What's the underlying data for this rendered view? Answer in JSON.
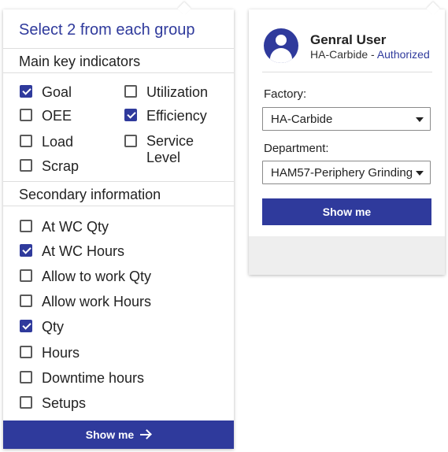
{
  "left_panel": {
    "title": "Select 2 from each group",
    "main_section": {
      "heading": "Main key indicators",
      "options": [
        {
          "label": "Goal",
          "checked": true
        },
        {
          "label": "Utilization",
          "checked": false
        },
        {
          "label": "OEE",
          "checked": false
        },
        {
          "label": "Efficiency",
          "checked": true
        },
        {
          "label": "Load",
          "checked": false
        },
        {
          "label": "Service Level",
          "checked": false
        },
        {
          "label": "Scrap",
          "checked": false
        }
      ]
    },
    "secondary_section": {
      "heading": "Secondary information",
      "options": [
        {
          "label": "At WC Qty",
          "checked": false
        },
        {
          "label": "At WC Hours",
          "checked": true
        },
        {
          "label": "Allow to work Qty",
          "checked": false
        },
        {
          "label": "Allow work Hours",
          "checked": false
        },
        {
          "label": "Qty",
          "checked": true
        },
        {
          "label": "Hours",
          "checked": false
        },
        {
          "label": "Downtime hours",
          "checked": false
        },
        {
          "label": "Setups",
          "checked": false
        }
      ]
    },
    "show_me_label": "Show me",
    "show_me_icon": "arrow-right-icon"
  },
  "right_panel": {
    "user_name": "Genral User",
    "user_org": "HA-Carbide",
    "separator": " - ",
    "user_status": "Authorized",
    "factory_label": "Factory:",
    "factory_value": "HA-Carbide",
    "department_label": "Department:",
    "department_value": "HAM57-Periphery Grinding",
    "show_me_label": "Show me"
  },
  "colors": {
    "accent": "#2f3a9c",
    "footer_bg": "#eeeeee"
  }
}
